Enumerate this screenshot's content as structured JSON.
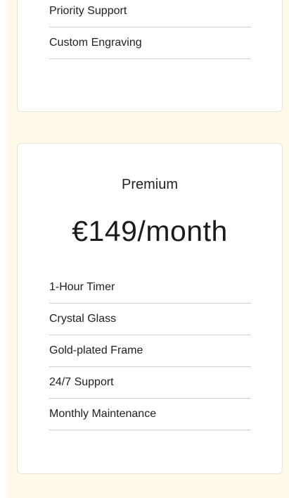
{
  "previous_plan": {
    "features": [
      "Priority Support",
      "Custom Engraving"
    ]
  },
  "premium_plan": {
    "name": "Premium",
    "price": "€149/month",
    "features": [
      "1-Hour Timer",
      "Crystal Glass",
      "Gold-plated Frame",
      "24/7 Support",
      "Monthly Maintenance"
    ]
  },
  "colors": {
    "page_background": "#fffbe8",
    "card_background": "#ffffff",
    "divider": "#d0d0d0"
  }
}
